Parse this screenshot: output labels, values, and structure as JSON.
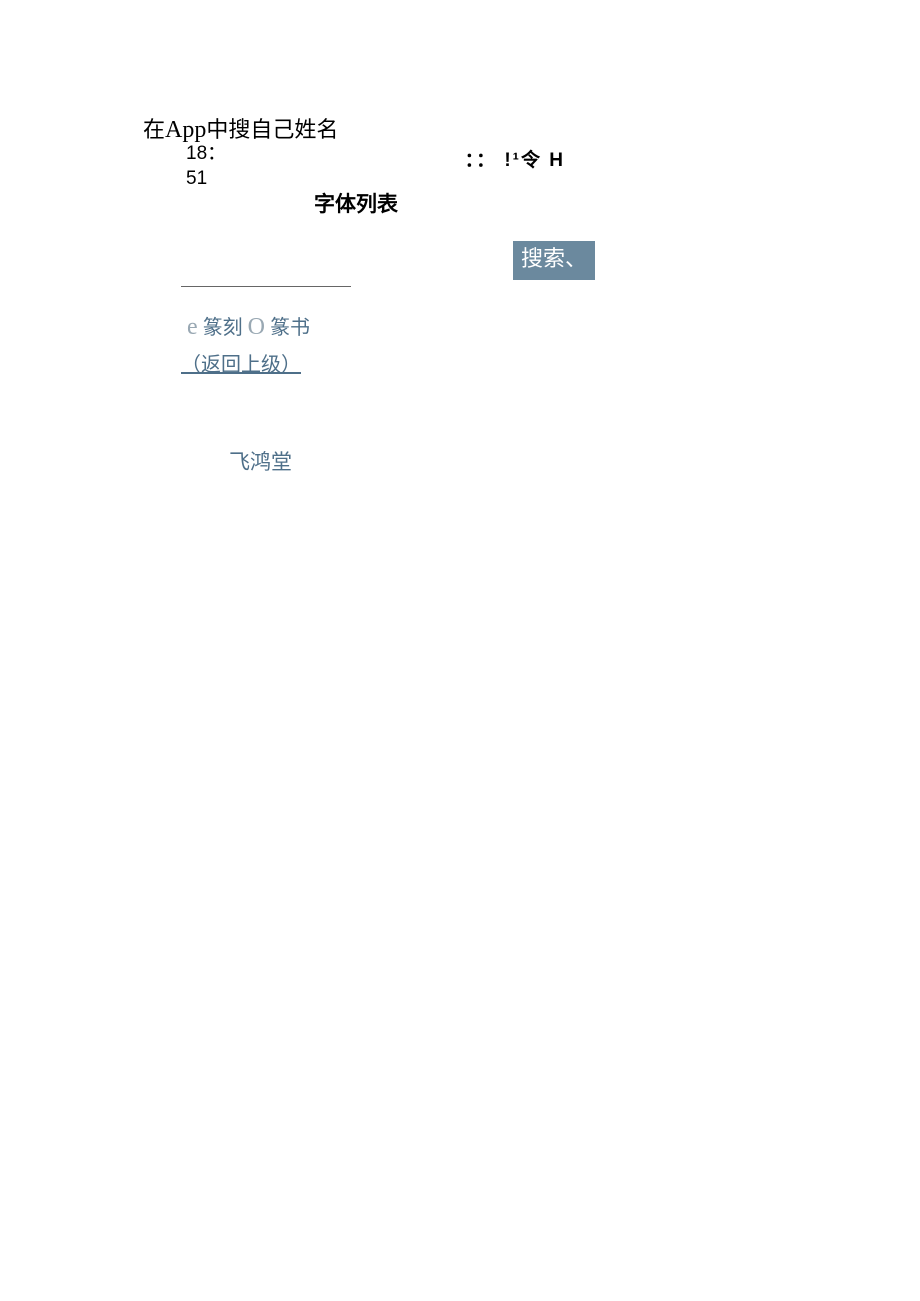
{
  "header": {
    "prefix": "在",
    "app_word": "App",
    "suffix": "中搜自己姓名",
    "time_line1": "18：",
    "time_line2": "51",
    "status_icons": "：： !¹令 H"
  },
  "page_title": "字体列表",
  "search_button": "搜索、",
  "options": {
    "bullet1": "e",
    "label1": "篆刻",
    "bullet2": "O",
    "label2": "篆书"
  },
  "return_link": "（返回上级）",
  "font_item": "飞鸿堂"
}
